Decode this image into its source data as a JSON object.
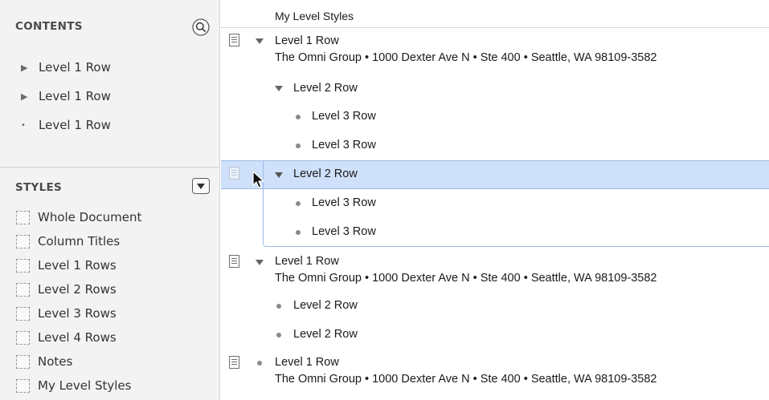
{
  "sidebar": {
    "contents_header": "CONTENTS",
    "styles_header": "STYLES",
    "search_icon": "magnifier-icon",
    "styles_menu_icon": "dropdown-triangle-icon",
    "contents_items": [
      {
        "label": "Level 1 Row",
        "glyph": "▶"
      },
      {
        "label": "Level 1 Row",
        "glyph": "▶"
      },
      {
        "label": "Level 1 Row",
        "glyph": "•"
      }
    ],
    "style_items": [
      {
        "label": "Whole Document"
      },
      {
        "label": "Column Titles"
      },
      {
        "label": "Level 1 Rows"
      },
      {
        "label": "Level 2 Rows"
      },
      {
        "label": "Level 3 Rows"
      },
      {
        "label": "Level 4 Rows"
      },
      {
        "label": "Notes"
      },
      {
        "label": "My Level Styles"
      }
    ]
  },
  "outline": {
    "column_title": "My Level Styles",
    "rows": [
      {
        "label": "Level 1 Row",
        "note": "The Omni Group • 1000 Dexter Ave N • Ste 400 • Seattle, WA 98109-3582"
      },
      {
        "label": "Level 2 Row"
      },
      {
        "label": "Level 3 Row"
      },
      {
        "label": "Level 3 Row"
      },
      {
        "label": "Level 2 Row",
        "selected": true
      },
      {
        "label": "Level 3 Row"
      },
      {
        "label": "Level 3 Row"
      },
      {
        "label": "Level 1 Row",
        "note": "The Omni Group • 1000 Dexter Ave N • Ste 400 • Seattle, WA 98109-3582"
      },
      {
        "label": "Level 2 Row"
      },
      {
        "label": "Level 2 Row"
      },
      {
        "label": "Level 1 Row",
        "note": "The Omni Group • 1000 Dexter Ave N • Ste 400 • Seattle, WA 98109-3582"
      }
    ]
  },
  "colors": {
    "selection": "#cfe0fa",
    "selection_border": "#9cbbe8",
    "sidebar_bg": "#f3f3f3"
  }
}
